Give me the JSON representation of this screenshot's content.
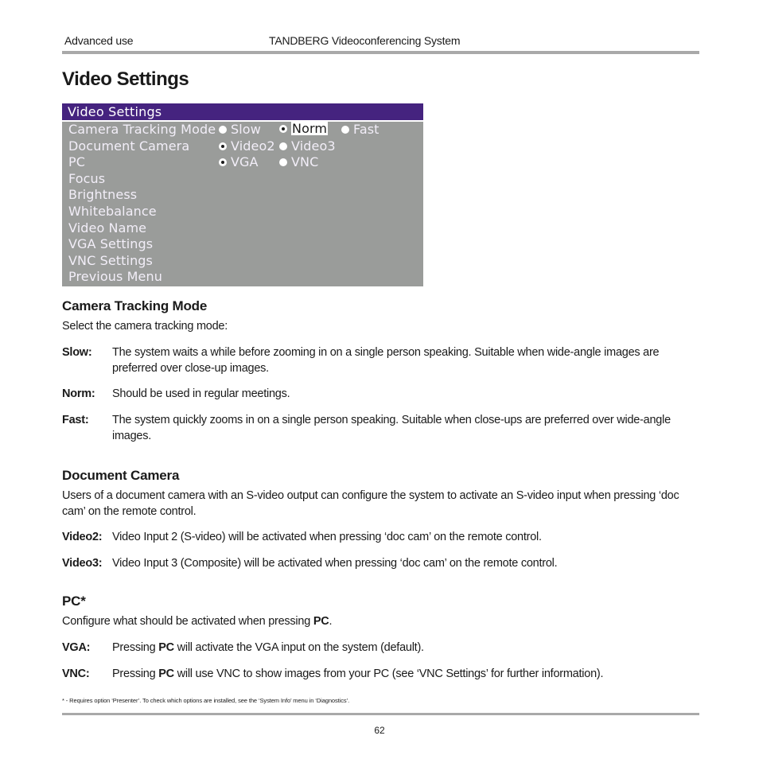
{
  "header": {
    "section": "Advanced use",
    "product": "TANDBERG Videoconferencing System"
  },
  "page_title": "Video Settings",
  "osd_menu": {
    "title": "Video Settings",
    "colors": {
      "title_bar": "#45237f",
      "background": "#9a9c9a",
      "text": "#f2eef8"
    },
    "rows": [
      {
        "label": "Camera Tracking Mode",
        "options": [
          {
            "label": "Slow",
            "selected": false
          },
          {
            "label": "Norm",
            "selected": true,
            "highlighted": true
          },
          {
            "label": "Fast",
            "selected": false
          }
        ]
      },
      {
        "label": "Document Camera",
        "options": [
          {
            "label": "Video2",
            "selected": true
          },
          {
            "label": "Video3",
            "selected": false
          }
        ]
      },
      {
        "label": "PC",
        "options": [
          {
            "label": "VGA",
            "selected": true
          },
          {
            "label": "VNC",
            "selected": false
          }
        ]
      },
      {
        "label": "Focus"
      },
      {
        "label": "Brightness"
      },
      {
        "label": "Whitebalance"
      },
      {
        "label": "Video Name"
      },
      {
        "label": "VGA Settings"
      },
      {
        "label": "VNC Settings"
      },
      {
        "label": "Previous Menu"
      }
    ]
  },
  "sections": {
    "camera_tracking": {
      "heading": "Camera Tracking Mode",
      "intro": "Select the camera tracking mode:",
      "defs": [
        {
          "term": "Slow:",
          "desc": "The system waits a while before zooming in on a single person speaking. Suitable when wide-angle images are preferred over close-up images."
        },
        {
          "term": "Norm:",
          "desc": "Should be used in regular meetings."
        },
        {
          "term": "Fast:",
          "desc": "The system quickly zooms in on a single person speaking. Suitable when close-ups are preferred over wide-angle images."
        }
      ]
    },
    "document_camera": {
      "heading": "Document Camera",
      "intro": "Users of a document camera with an S-video output can configure the system to activate an S-video input when pressing ‘doc cam’ on the remote control.",
      "defs": [
        {
          "term": "Video2:",
          "desc": "Video Input 2 (S-video) will be activated when pressing ‘doc cam’ on the remote control."
        },
        {
          "term": "Video3:",
          "desc": "Video Input 3 (Composite) will be activated when pressing ‘doc cam’ on the remote control."
        }
      ]
    },
    "pc": {
      "heading": "PC*",
      "intro_pre": "Configure what should be activated when pressing ",
      "intro_bold": "PC",
      "intro_post": ".",
      "defs": [
        {
          "term": "VGA:",
          "pre": "Pressing ",
          "bold": "PC",
          "post": " will activate the VGA input on the system (default)."
        },
        {
          "term": "VNC:",
          "pre": "Pressing ",
          "bold": "PC",
          "post": " will use VNC to show images from your PC (see ‘VNC Settings’ for further information)."
        }
      ]
    }
  },
  "footnote": "* - Requires option ‘Presenter’. To check which options are installed, see the ‘System Info’ menu in ‘Diagnostics’.",
  "page_number": "62"
}
